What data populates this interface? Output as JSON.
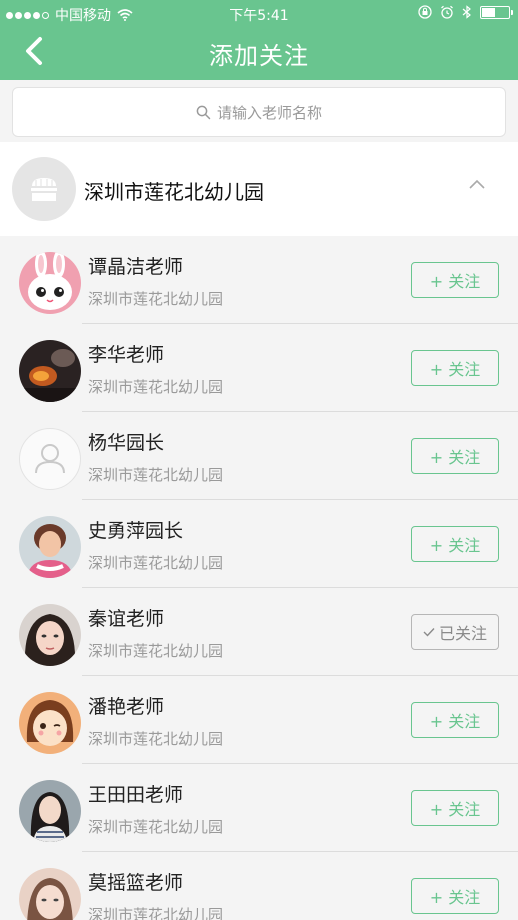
{
  "status_bar": {
    "carrier": "中国移动",
    "time": "下午5:41"
  },
  "nav": {
    "title": "添加关注"
  },
  "search": {
    "placeholder": "请输入老师名称"
  },
  "group": {
    "name": "深圳市莲花北幼儿园"
  },
  "teachers": [
    {
      "name": "谭晶洁老师",
      "school": "深圳市莲花北幼儿园",
      "button": "+ 关注",
      "followed": false
    },
    {
      "name": "李华老师",
      "school": "深圳市莲花北幼儿园",
      "button": "+ 关注",
      "followed": false
    },
    {
      "name": "杨华园长",
      "school": "深圳市莲花北幼儿园",
      "button": "+ 关注",
      "followed": false
    },
    {
      "name": "史勇萍园长",
      "school": "深圳市莲花北幼儿园",
      "button": "+ 关注",
      "followed": false
    },
    {
      "name": "秦谊老师",
      "school": "深圳市莲花北幼儿园",
      "button": "已关注",
      "followed": true
    },
    {
      "name": "潘艳老师",
      "school": "深圳市莲花北幼儿园",
      "button": "+ 关注",
      "followed": false
    },
    {
      "name": "王田田老师",
      "school": "深圳市莲花北幼儿园",
      "button": "+ 关注",
      "followed": false
    },
    {
      "name": "莫摇篮老师",
      "school": "深圳市莲花北幼儿园",
      "button": "+ 关注",
      "followed": false
    }
  ],
  "colors": {
    "accent": "#69c58f",
    "followed_border": "#b6b6b6"
  }
}
